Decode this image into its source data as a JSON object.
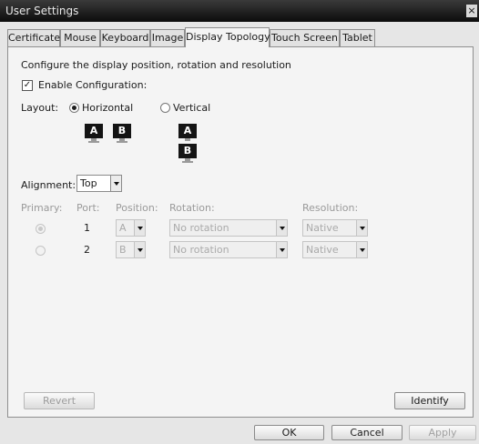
{
  "window": {
    "title": "User Settings",
    "close_glyph": "×"
  },
  "tabs": [
    {
      "label": "Certificate",
      "active": false
    },
    {
      "label": "Mouse",
      "active": false
    },
    {
      "label": "Keyboard",
      "active": false
    },
    {
      "label": "Image",
      "active": false
    },
    {
      "label": "Display Topology",
      "active": true
    },
    {
      "label": "Touch Screen",
      "active": false
    },
    {
      "label": "Tablet",
      "active": false
    }
  ],
  "panel": {
    "description": "Configure the display position, rotation and resolution",
    "enable_config": {
      "label": "Enable Configuration:",
      "checked": true,
      "check_glyph": "✓"
    },
    "layout": {
      "label": "Layout:",
      "horizontal_label": "Horizontal",
      "vertical_label": "Vertical",
      "selected": "Horizontal",
      "monitor_a": "A",
      "monitor_b": "B"
    },
    "alignment": {
      "label": "Alignment:",
      "value": "Top"
    },
    "table": {
      "headers": {
        "primary": "Primary:",
        "port": "Port:",
        "position": "Position:",
        "rotation": "Rotation:",
        "resolution": "Resolution:"
      },
      "rows": [
        {
          "primary_selected": true,
          "port": "1",
          "position": "A",
          "rotation": "No rotation",
          "resolution": "Native"
        },
        {
          "primary_selected": false,
          "port": "2",
          "position": "B",
          "rotation": "No rotation",
          "resolution": "Native"
        }
      ]
    },
    "revert_label": "Revert",
    "identify_label": "Identify"
  },
  "footer": {
    "ok_label": "OK",
    "cancel_label": "Cancel",
    "apply_label": "Apply"
  }
}
